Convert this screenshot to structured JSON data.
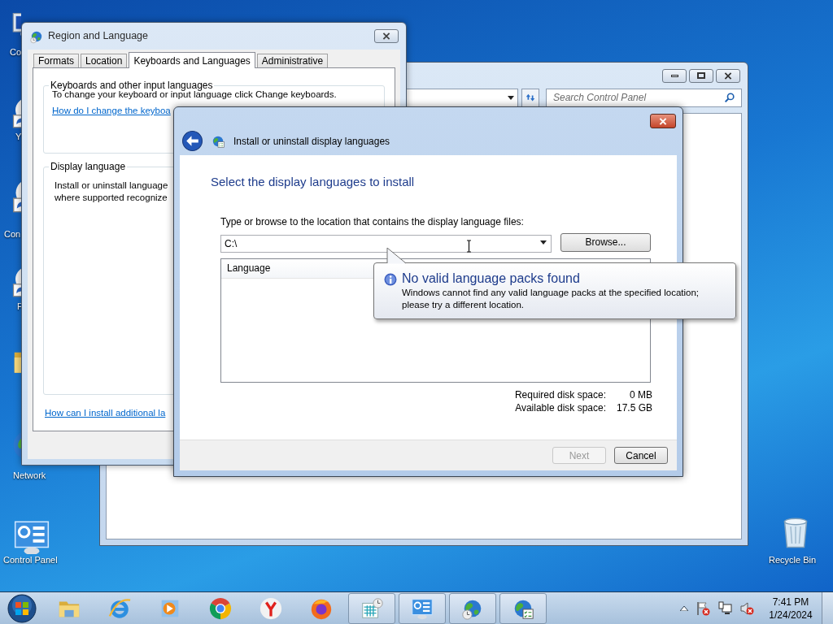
{
  "desktop_icons": [
    {
      "kind": "computer",
      "label": "Co"
    },
    {
      "kind": "shortcut",
      "label": "Y"
    },
    {
      "kind": "shortcut",
      "label": "Con"
    },
    {
      "kind": "shortcut",
      "label": "F"
    },
    {
      "kind": "folder"
    },
    {
      "kind": "network",
      "label": "Network"
    },
    {
      "kind": "control_panel",
      "label": "Control Panel"
    },
    {
      "kind": "recycle_bin",
      "label": "Recycle Bin"
    }
  ],
  "control_panel_window": {
    "search": {
      "placeholder": "Search Control Panel"
    }
  },
  "region_window": {
    "title": "Region and Language",
    "tabs": [
      {
        "label": "Formats",
        "selected": false
      },
      {
        "label": "Location",
        "selected": false
      },
      {
        "label": "Keyboards and Languages",
        "selected": true
      },
      {
        "label": "Administrative",
        "selected": false
      }
    ],
    "keyboards_group": {
      "title": "Keyboards and other input languages",
      "text": "To change your keyboard or input language click Change keyboards.",
      "link": "How do I change the keyboa"
    },
    "display_group": {
      "title": "Display language",
      "lines": [
        "Install or uninstall language",
        "where supported recognize"
      ]
    },
    "link": "How can I install additional la"
  },
  "dialog": {
    "title": "Install or uninstall display languages",
    "heading": "Select the display languages to install",
    "location_label": "Type or browse to the location that contains the display language files:",
    "location_value": "C:\\",
    "browse_button": "Browse...",
    "list_columns": [
      "Language"
    ],
    "disk_space": [
      {
        "label": "Required disk space:",
        "value": "0 MB"
      },
      {
        "label": "Available disk space:",
        "value": "17.5 GB"
      }
    ],
    "buttons": [
      {
        "label": "Next",
        "disabled": true
      },
      {
        "label": "Cancel",
        "disabled": false
      }
    ]
  },
  "balloon": {
    "title": "No valid language packs found",
    "text": "Windows cannot find any valid language packs at the specified location; please try a different location."
  },
  "taskbar": {
    "items": [
      {
        "kind": "folder",
        "open": false
      },
      {
        "kind": "browser_e",
        "open": false
      },
      {
        "kind": "media",
        "open": false
      },
      {
        "kind": "chrome",
        "open": false
      },
      {
        "kind": "yandex",
        "open": false
      },
      {
        "kind": "firefox",
        "open": false
      },
      {
        "kind": "calendar_clock",
        "open": true
      },
      {
        "kind": "control_panel",
        "open": true
      },
      {
        "kind": "globe_clock",
        "open": true
      },
      {
        "kind": "globe_list",
        "open": true
      }
    ],
    "clock": {
      "time": "7:41 PM",
      "date": "1/24/2024"
    }
  }
}
